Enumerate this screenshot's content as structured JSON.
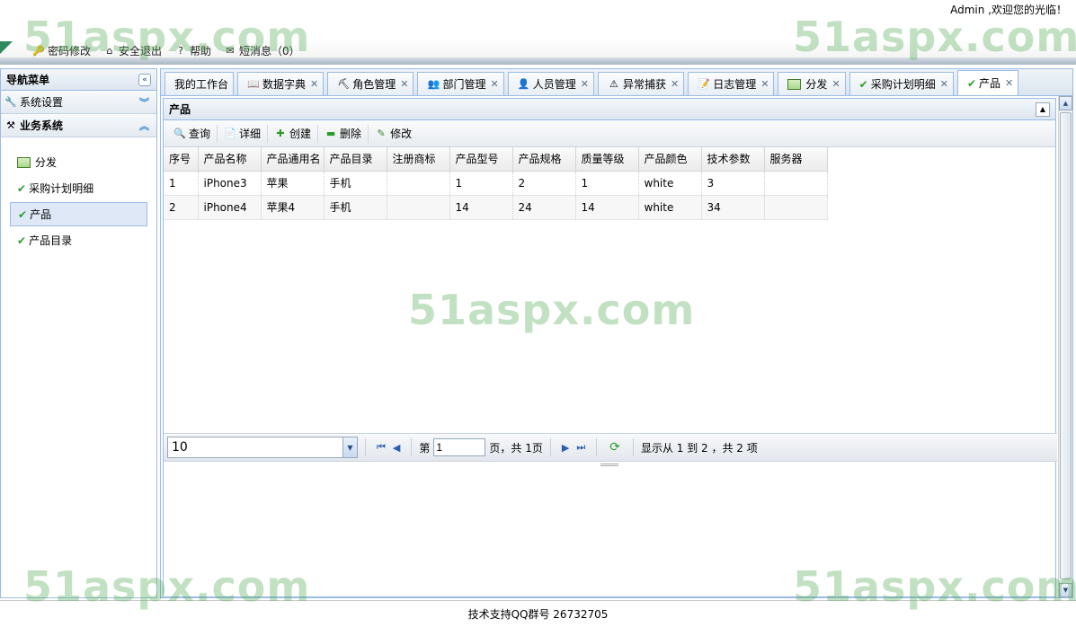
{
  "header": {
    "greeting": "Admin ,欢迎您的光临！",
    "links": [
      {
        "label": "密码修改",
        "icon": "key-icon"
      },
      {
        "label": "安全退出",
        "icon": "exit-icon"
      },
      {
        "label": "帮助",
        "icon": "help-icon"
      },
      {
        "label": "短消息（0）",
        "icon": "message-icon"
      }
    ]
  },
  "sidebar": {
    "title": "导航菜单",
    "sections": [
      {
        "label": "系统设置",
        "icon": "wrench-icon"
      },
      {
        "label": "业务系统",
        "icon": "tools-icon"
      }
    ],
    "items": [
      {
        "label": "分发",
        "icon": "grid-icon"
      },
      {
        "label": "采购计划明细",
        "icon": "check-icon"
      },
      {
        "label": "产品",
        "icon": "check-icon"
      },
      {
        "label": "产品目录",
        "icon": "check-icon"
      }
    ]
  },
  "tabs": [
    {
      "label": "我的工作台"
    },
    {
      "label": "数据字典"
    },
    {
      "label": "角色管理"
    },
    {
      "label": "部门管理"
    },
    {
      "label": "人员管理"
    },
    {
      "label": "异常捕获"
    },
    {
      "label": "日志管理"
    },
    {
      "label": "分发"
    },
    {
      "label": "采购计划明细"
    },
    {
      "label": "产品"
    }
  ],
  "panel": {
    "title": "产品",
    "toolbar": [
      "查询",
      "详细",
      "创建",
      "删除",
      "修改"
    ]
  },
  "table": {
    "columns": [
      "序号",
      "产品名称",
      "产品通用名",
      "产品目录",
      "注册商标",
      "产品型号",
      "产品规格",
      "质量等级",
      "产品颜色",
      "技术参数",
      "服务器"
    ],
    "rows": [
      [
        "1",
        "iPhone3",
        "苹果",
        "手机",
        "",
        "1",
        "2",
        "1",
        "white",
        "3",
        ""
      ],
      [
        "2",
        "iPhone4",
        "苹果4",
        "手机",
        "",
        "14",
        "24",
        "14",
        "white",
        "34",
        ""
      ]
    ]
  },
  "pager": {
    "page_size": "10",
    "page_prefix": "第",
    "page_value": "1",
    "page_suffix": "页，共 1页",
    "summary": "显示从 1 到 2 ，共 2 项"
  },
  "footer": {
    "text": "技术支持QQ群号 26732705"
  },
  "watermark": "51aspx.com"
}
